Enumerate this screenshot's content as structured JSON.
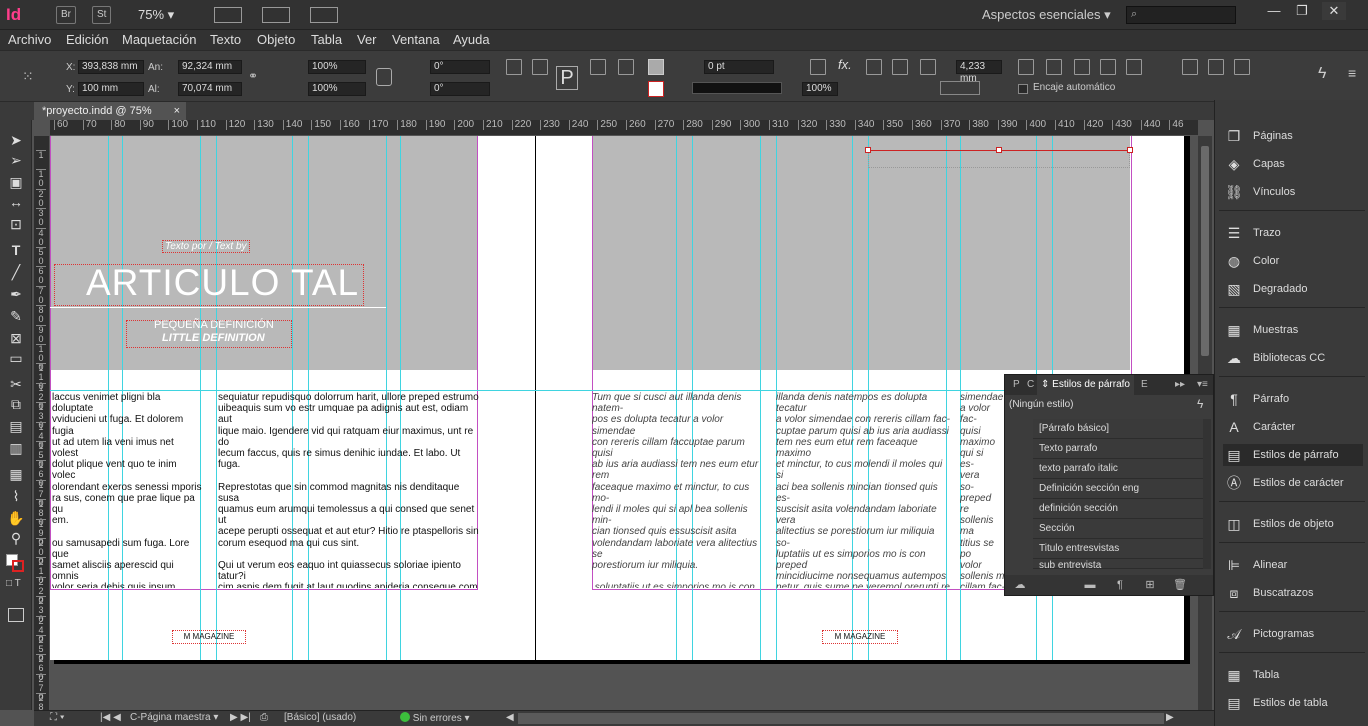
{
  "appbar": {
    "logo": "Id",
    "btn_bridge": "Br",
    "btn_stock": "St",
    "zoom": "75%",
    "workspace": "Aspectos esenciales",
    "win_min": "—",
    "win_max": "❐",
    "win_close": "✕"
  },
  "menu": [
    "Archivo",
    "Edición",
    "Maquetación",
    "Texto",
    "Objeto",
    "Tabla",
    "Ver",
    "Ventana",
    "Ayuda"
  ],
  "control": {
    "x_label": "X:",
    "x_value": "393,838 mm",
    "y_label": "Y:",
    "y_value": "100 mm",
    "w_label": "An:",
    "w_value": "92,324 mm",
    "h_label": "Al:",
    "h_value": "70,074 mm",
    "scale_x": "100%",
    "scale_y": "100%",
    "rotate": "0°",
    "shear": "0°",
    "stroke": "0 pt",
    "opacity": "100%",
    "gap": "4,233 mm",
    "autofit_label": "Encaje automático"
  },
  "doc_tab": {
    "title": "*proyecto.indd @ 75%",
    "close": "×"
  },
  "ruler": [
    "60",
    "70",
    "80",
    "90",
    "100",
    "110",
    "120",
    "130",
    "140",
    "150",
    "160",
    "170",
    "180",
    "190",
    "200",
    "210",
    "220",
    "230",
    "240",
    "250",
    "260",
    "270",
    "280",
    "290",
    "300",
    "310",
    "320",
    "330",
    "340",
    "350",
    "360",
    "370",
    "380",
    "390",
    "400",
    "410",
    "420",
    "430",
    "440",
    "46"
  ],
  "vruler": [
    "1",
    "1\n0",
    "2\n0",
    "3\n0",
    "4\n0",
    "5\n0",
    "6\n0",
    "7\n0",
    "8\n0",
    "9\n0",
    "1\n0\n0",
    "1\n1\n0",
    "1\n2\n0",
    "1\n3\n0",
    "1\n4\n0",
    "1\n5\n0",
    "1\n6\n0",
    "1\n7\n0",
    "1\n8\n0",
    "1\n9\n0",
    "2\n0\n0",
    "2\n1\n0",
    "2\n2\n0",
    "2\n3\n0",
    "2\n4\n0",
    "2\n5\n0",
    "2\n6\n0",
    "2\n7\n0",
    "2\n8\n0"
  ],
  "spread": {
    "byline": "Texto por / Text by",
    "title": "ARTICULO TAL",
    "subtitle1": "PEQUEÑA DEFINICIÓN",
    "subtitle2": "LITTLE DEFINITION",
    "footer_left": "M MAGAZINE ",
    "footer_right": "M MAGAZINE ",
    "col1": "laccus venimet pligni bla doluptate\nvviducieni ut fuga. Et dolorem fugia\nut ad utem lia veni imus net volest\ndolut plique vent quo te inim volec\nolorendant exeros senessi mporis\nra sus, conem que prae lique pa qu\nem.\n\nou samusapedi sum fuga. Lore que\nsamet alisciis aperescid qui omnis\nvolor seria debis quis ipsum incius\nta tquidipsa que reprend aniscim\nigit hilis aut doluptaquas ea dolese\nupta vel ma as aut quis eumendios.\n\nnsa il iusam expliquam fugit ma non",
    "col2": "sequiatur repudisquo dolorrum harit, ullore preped estrumo\nuibeaquis sum vo estr umquae pa adignis aut est, odiam aut\nlique maio. Igendere vid qui ratquam eiur maximus, unt re do\nlecum faccus, quis re simus denihic iundae. Et labo. Ut fuga.\n\nReprestotas que sin commod magnitas nis denditaque susa\nquamus eum arumqui temolessus a qui consed que senet ut\nacepe perupti ossequat et aut etur? Hitio re ptaspelloris sin\ncorum esequod ma qui cus sint.\n\nQui ut verum eos eaquo int quiassecus soloriae ipiento tatur?i\ncim aspis dem fugit at laut quodips apideria conseque com\nUs sequam rem eum fugiam dolupta tecus.\n\nOtaqui omnient oresendi omnis etuscitin es essuntio mil inc\nturehenet pellabo. Nem reictas nossit, ime dem labore sam",
    "col3": "Tum que si cusci aut illanda denis natem-\npos es dolupta tecatur a volor simendae\ncon rereris cillam faccuptae parum quisi\nab ius aria audiassi tem nes eum etur rem\nfaceaque maximo et minctur, to cus mo-\nlendi il moles qui si apl bea sollenis min-\ncian tionsed quis essuscisit asita\nvolendandam laboriate vera alitectius se\nporestiorum iur miliquia.\n\n soluptatiis ut es simporios mo is con pre-\nped mincidiucime nonsequamus autem-\npos netur, quis sume pe veremol orerunti\nre nossumquas ditiis rem sit quat et, iur\nsum sequiducil exerunt.Ut aur sint ulpa\ncomnihi litatibus.Tum que si cusci aut",
    "col4": "illanda denis natempos es dolupta tecatur\na volor simendae con rereris cillam fac-\ncuptae parum quisi ab ius aria audiassi\ntem nes eum etur rem faceaque maximo\net minctur, to cus molendi il moles qui si\naci bea sollenis mincian tionsed quis es-\nsuscisit asita volendandam laboriate vera\nalitectius se porestiorum iur miliquia so-\nluptatiis ut es simporios mo is con preped\nmincidiucime nonsequamus autempos\nnetur, quis sume pe veremol orerunti re\nnossumquas ditiis\n\nrem sit quat et, iur sum sequiducil\nexerunt. Tum que si cusci aut illanda de-\nnis natempos es dolupta tecatur a volor",
    "col5": "simendae\na volor\nfac-\nquisi\nmaximo\nqui si\nes-\nvera\nso-\npreped\nre\nsollenis ma\ntitius se po\nvolor\nsollenis m\ncillam fac-"
  },
  "rpanel": {
    "paginas": "Páginas",
    "capas": "Capas",
    "vinculos": "Vínculos",
    "trazo": "Trazo",
    "color": "Color",
    "degradado": "Degradado",
    "muestras": "Muestras",
    "bibliotecas": "Bibliotecas CC",
    "parrafo": "Párrafo",
    "caracter": "Carácter",
    "estilos_parrafo": "Estilos de párrafo",
    "estilos_caracter": "Estilos de carácter",
    "estilos_objeto": "Estilos de objeto",
    "alinear": "Alinear",
    "buscatrazos": "Buscatrazos",
    "pictogramas": "Pictogramas",
    "tabla": "Tabla",
    "estilos_tabla": "Estilos de tabla"
  },
  "pstyles": {
    "tab1": "P",
    "tab2": "C",
    "tab_active": "Estilos de párrafo",
    "tab4": "E",
    "current": "(Ningún estilo)",
    "items": [
      "[Párrafo básico]",
      "Texto parrafo",
      "texto parrafo italic",
      "Definición sección eng",
      "definición sección",
      "Sección",
      "Titulo entresvistas",
      "sub entrevista"
    ]
  },
  "status": {
    "page": "C-Página maestra",
    "style": "[Básico] (usado)",
    "errors": "Sin errores"
  },
  "colors": {
    "accent": "#ff3d8b",
    "guide": "#3fd4e0",
    "margin": "#c24fc2",
    "ok": "#3cbf3c"
  }
}
